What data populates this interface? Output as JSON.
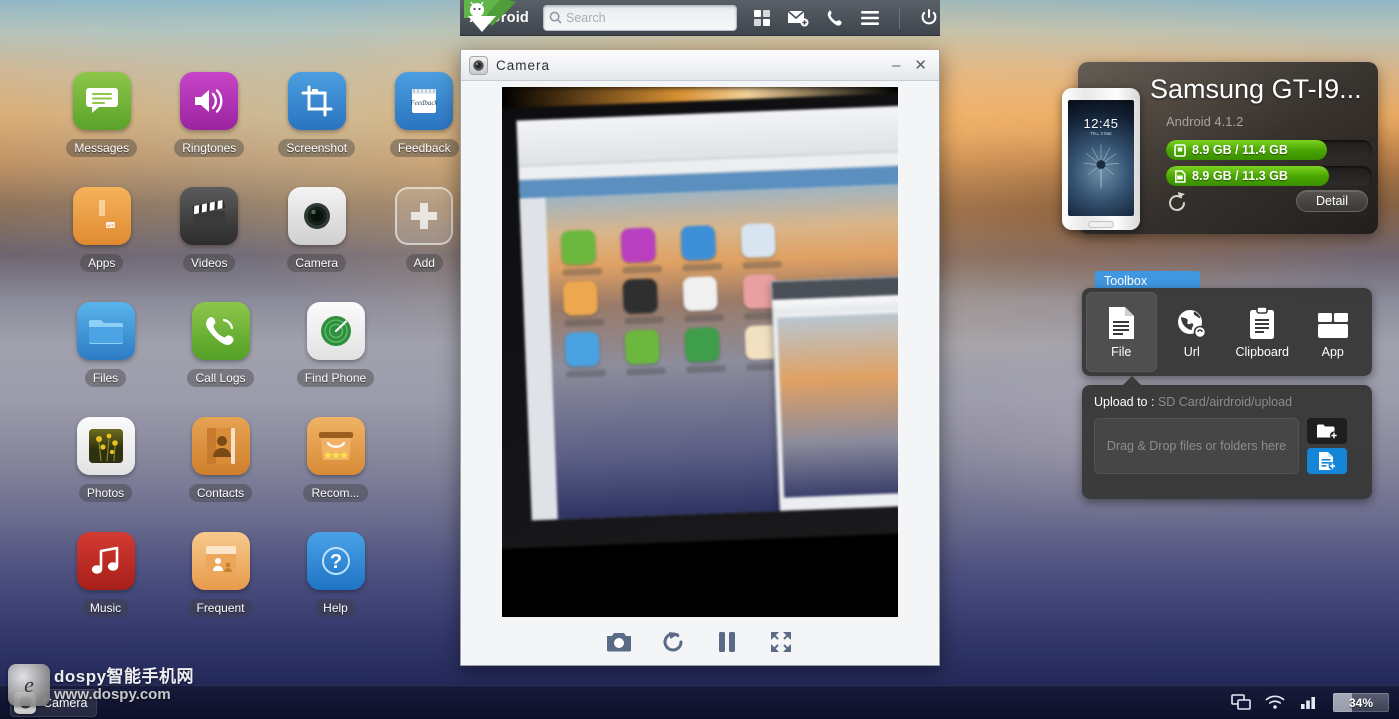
{
  "header": {
    "brand": "AirDroid",
    "logo_icon": "airdroid-logo-icon",
    "search": {
      "placeholder": "Search",
      "value": "",
      "icon": "search-icon"
    },
    "icons": [
      {
        "name": "apps-grid-icon",
        "label": "Apps"
      },
      {
        "name": "new-message-icon",
        "label": "Messages"
      },
      {
        "name": "phone-icon",
        "label": "Call"
      },
      {
        "name": "menu-icon",
        "label": "Menu"
      },
      {
        "name": "power-icon",
        "label": "Power"
      }
    ]
  },
  "desktop": {
    "rows": [
      [
        {
          "label": "Messages",
          "icon": "messages-icon",
          "cls": "ic-messages"
        },
        {
          "label": "Ringtones",
          "icon": "ringtones-icon",
          "cls": "ic-ringtones"
        },
        {
          "label": "Screenshot",
          "icon": "screenshot-icon",
          "cls": "ic-screenshot"
        },
        {
          "label": "Feedback",
          "icon": "feedback-icon",
          "cls": "ic-feedback"
        }
      ],
      [
        {
          "label": "Apps",
          "icon": "apps-icon",
          "cls": "ic-apps"
        },
        {
          "label": "Videos",
          "icon": "videos-icon",
          "cls": "ic-videos"
        },
        {
          "label": "Camera",
          "icon": "camera-icon",
          "cls": "ic-camera"
        },
        {
          "label": "Add",
          "icon": "add-icon",
          "cls": "ic-add"
        }
      ],
      [
        {
          "label": "Files",
          "icon": "files-icon",
          "cls": "ic-files"
        },
        {
          "label": "Call Logs",
          "icon": "call-logs-icon",
          "cls": "ic-calllogs"
        },
        {
          "label": "Find Phone",
          "icon": "find-phone-icon",
          "cls": "ic-findphone"
        }
      ],
      [
        {
          "label": "Photos",
          "icon": "photos-icon",
          "cls": "ic-photos"
        },
        {
          "label": "Contacts",
          "icon": "contacts-icon",
          "cls": "ic-contacts"
        },
        {
          "label": "Recom...",
          "icon": "recommend-icon",
          "cls": "ic-recom"
        }
      ],
      [
        {
          "label": "Music",
          "icon": "music-icon",
          "cls": "ic-music"
        },
        {
          "label": "Frequent",
          "icon": "frequent-icon",
          "cls": "ic-frequent"
        },
        {
          "label": "Help",
          "icon": "help-icon",
          "cls": "ic-help"
        }
      ]
    ]
  },
  "camera_window": {
    "title": "Camera",
    "title_icon": "camera-lens-icon",
    "minimize_label": "–",
    "close_label": "✕",
    "controls": [
      {
        "name": "capture-photo-button",
        "icon": "camera-icon"
      },
      {
        "name": "switch-camera-button",
        "icon": "rotate-icon"
      },
      {
        "name": "pause-button",
        "icon": "pause-icon"
      },
      {
        "name": "fullscreen-button",
        "icon": "fullscreen-icon"
      }
    ]
  },
  "device": {
    "name": "Samsung GT-I9...",
    "os": "Android 4.1.2",
    "phone_time": "12:45",
    "phone_date": "Thu, 3 Mar",
    "storage": [
      {
        "icon": "internal-storage-icon",
        "text": "8.9 GB / 11.4 GB",
        "used": 8.9,
        "total": 11.4,
        "percent": 78
      },
      {
        "icon": "sd-card-icon",
        "text": "8.9 GB / 11.3 GB",
        "used": 8.9,
        "total": 11.3,
        "percent": 79
      }
    ],
    "refresh_icon": "refresh-icon",
    "detail_label": "Detail",
    "accent_green": "#47a400"
  },
  "toolbox": {
    "tab_label": "Toolbox",
    "tab_color": "#3f97e0",
    "tools": [
      {
        "label": "File",
        "icon": "file-icon",
        "active": true
      },
      {
        "label": "Url",
        "icon": "url-globe-icon",
        "active": false
      },
      {
        "label": "Clipboard",
        "icon": "clipboard-icon",
        "active": false
      },
      {
        "label": "App",
        "icon": "app-box-icon",
        "active": false
      }
    ],
    "upload": {
      "label": "Upload to : ",
      "path": "SD Card/airdroid/upload",
      "dropzone": "Drag & Drop files or folders here",
      "add_folder_icon": "add-folder-icon",
      "add_file_icon": "add-file-icon",
      "add_file_color": "#1585d8"
    }
  },
  "taskbar": {
    "items": [
      {
        "label": "Camera",
        "icon": "camera-icon"
      }
    ],
    "tray": [
      {
        "name": "network-icon"
      },
      {
        "name": "wifi-icon"
      },
      {
        "name": "signal-icon"
      }
    ],
    "battery": {
      "percent_label": "34%",
      "percent": 34
    }
  },
  "watermark": {
    "logo_letter": "e",
    "line1": "dospy智能手机网",
    "line2": "www.dospy.com"
  }
}
